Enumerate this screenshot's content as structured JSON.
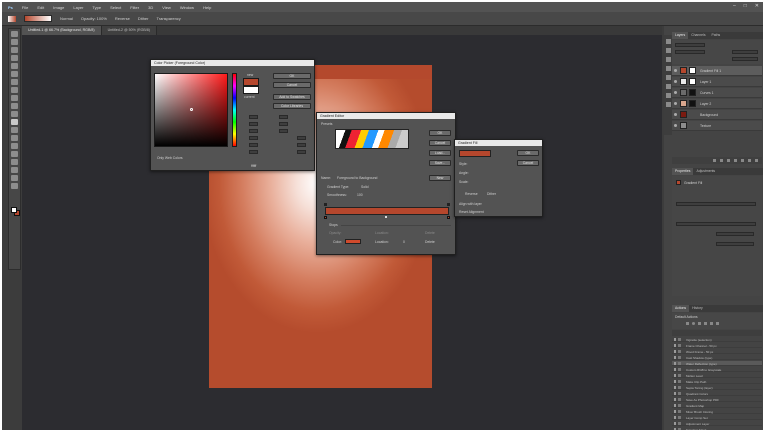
{
  "menu": [
    "File",
    "Edit",
    "Image",
    "Layer",
    "Type",
    "Select",
    "Filter",
    "3D",
    "View",
    "Window",
    "Help"
  ],
  "window_controls": [
    "–",
    "□",
    "✕"
  ],
  "options_bar": {
    "mode_label": "Normal",
    "opacity_label": "Opacity: 100%",
    "reverse_label": "Reverse",
    "dither_label": "Dither",
    "transparency_label": "Transparency"
  },
  "tabs": [
    {
      "label": "Untitled-1 @ 66.7% (Background, RGB/8)"
    },
    {
      "label": "Untitled-2 @ 50% (RGB/8)"
    }
  ],
  "color_picker": {
    "title": "Color Picker (Foreground Color)",
    "ok": "OK",
    "cancel": "Cancel",
    "new_label": "new",
    "current_label": "current",
    "add_swatches": "Add to Swatches",
    "color_libraries": "Color Libraries",
    "only_web": "Only Web Colors",
    "hex_value": "ffffff",
    "current_color": "#ffffff",
    "new_color": "#b5472d"
  },
  "gradient_editor": {
    "title": "Gradient Editor",
    "presets_label": "Presets",
    "ok": "OK",
    "cancel": "Cancel",
    "load": "Load...",
    "save": "Save...",
    "name_label": "Name:",
    "name_value": "Foreground to Background",
    "new_button": "New",
    "gradient_type_label": "Gradient Type:",
    "gradient_type_value": "Solid",
    "smoothness_label": "Smoothness:",
    "smoothness_value": "100",
    "stops_label": "Stops",
    "opacity_label": "Opacity:",
    "location_label": "Location:",
    "delete": "Delete",
    "color_label": "Color:",
    "color_location_label": "Location:",
    "color_location_value": "0",
    "color_delete": "Delete",
    "gradient_color": "#b5472d"
  },
  "gradient_fill": {
    "title": "Gradient Fill",
    "ok": "OK",
    "cancel": "Cancel",
    "style_label": "Style:",
    "angle_label": "Angle:",
    "scale_label": "Scale:",
    "reverse_label": "Reverse",
    "dither_label": "Dither",
    "align_label": "Align with layer",
    "reset_label": "Reset Alignment"
  },
  "layers_panel": {
    "tabs": [
      "Layers",
      "Channels",
      "Paths"
    ],
    "rows": [
      {
        "name": "Gradient Fill 1",
        "thumb": "#b5472d",
        "mask": "#ffffff"
      },
      {
        "name": "Layer 1",
        "thumb": "#e8e8e8",
        "mask": "#ffffff"
      },
      {
        "name": "Curves 1",
        "thumb": "#6b6b6b",
        "mask": "#111111"
      },
      {
        "name": "Layer 2",
        "thumb": "#d9a78e",
        "mask": "#111111"
      },
      {
        "name": "Background",
        "thumb": "#7a1a10",
        "mask": ""
      },
      {
        "name": "Texture",
        "thumb": "#8c8c8c",
        "mask": ""
      }
    ]
  },
  "properties_panel": {
    "tabs": [
      "Properties",
      "Adjustments"
    ],
    "section_label": "Gradient Fill"
  },
  "actions_panel": {
    "tabs": [
      "Actions",
      "History"
    ],
    "set_label": "Default Actions",
    "rows": [
      {
        "name": "Vignette (selection)",
        "tag": ""
      },
      {
        "name": "Frame Channel - 50 px",
        "tag": ""
      },
      {
        "name": "Wood Frame - 50 px",
        "tag": ""
      },
      {
        "name": "Cast Shadow (type)",
        "tag": ""
      },
      {
        "name": "Water Reflection (type)",
        "tag": ""
      },
      {
        "name": "Custom RGB to Grayscale",
        "tag": ""
      },
      {
        "name": "Molten Lead",
        "tag": ""
      },
      {
        "name": "Make Clip Path",
        "tag": ""
      },
      {
        "name": "Sepia Toning (layer)",
        "tag": ""
      },
      {
        "name": "Quadrant Colors",
        "tag": ""
      },
      {
        "name": "Save As Photoshop PDF",
        "tag": ""
      },
      {
        "name": "Gradient Map",
        "tag": ""
      },
      {
        "name": "Mixer Brush Cloning",
        "tag": ""
      },
      {
        "name": "Layer Comp Set",
        "tag": ""
      },
      {
        "name": "Adjustment Layer",
        "tag": ""
      },
      {
        "name": "Selection Mask",
        "tag": ""
      }
    ]
  },
  "colors": {
    "accent": "#b5472d",
    "workspace": "#2c2c30",
    "panel": "#444444"
  }
}
